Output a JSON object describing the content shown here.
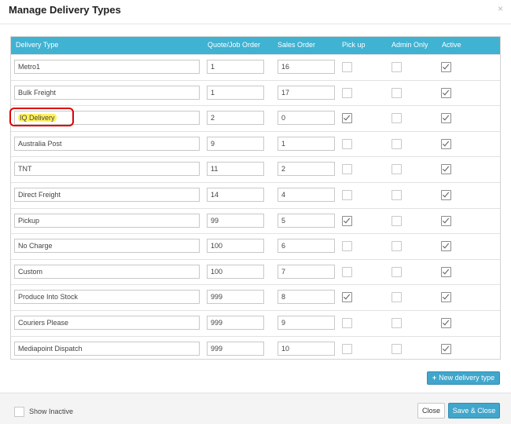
{
  "dialog": {
    "title": "Manage Delivery Types",
    "close_glyph": "×"
  },
  "table": {
    "columns": [
      "Delivery Type",
      "Quote/Job Order",
      "Sales Order",
      "Pick up",
      "Admin Only",
      "Active"
    ],
    "rows": [
      {
        "name": "Metro1",
        "quote_order": "1",
        "sales_order": "16",
        "pickup": false,
        "admin_only": false,
        "active": true
      },
      {
        "name": "Bulk Freight",
        "quote_order": "1",
        "sales_order": "17",
        "pickup": false,
        "admin_only": false,
        "active": true
      },
      {
        "name": "IQ Delivery",
        "quote_order": "2",
        "sales_order": "0",
        "pickup": true,
        "admin_only": false,
        "active": true
      },
      {
        "name": "Australia Post",
        "quote_order": "9",
        "sales_order": "1",
        "pickup": false,
        "admin_only": false,
        "active": true
      },
      {
        "name": "TNT",
        "quote_order": "11",
        "sales_order": "2",
        "pickup": false,
        "admin_only": false,
        "active": true
      },
      {
        "name": "Direct Freight",
        "quote_order": "14",
        "sales_order": "4",
        "pickup": false,
        "admin_only": false,
        "active": true
      },
      {
        "name": "Pickup",
        "quote_order": "99",
        "sales_order": "5",
        "pickup": true,
        "admin_only": false,
        "active": true
      },
      {
        "name": "No Charge",
        "quote_order": "100",
        "sales_order": "6",
        "pickup": false,
        "admin_only": false,
        "active": true
      },
      {
        "name": "Custom",
        "quote_order": "100",
        "sales_order": "7",
        "pickup": false,
        "admin_only": false,
        "active": true
      },
      {
        "name": "Produce Into Stock",
        "quote_order": "999",
        "sales_order": "8",
        "pickup": true,
        "admin_only": false,
        "active": true
      },
      {
        "name": "Couriers Please",
        "quote_order": "999",
        "sales_order": "9",
        "pickup": false,
        "admin_only": false,
        "active": true
      },
      {
        "name": "Mediapoint Dispatch",
        "quote_order": "999",
        "sales_order": "10",
        "pickup": false,
        "admin_only": false,
        "active": true
      }
    ]
  },
  "actions": {
    "new_icon": "plus-icon",
    "new_label": "New delivery type",
    "show_inactive_label": "Show Inactive",
    "show_inactive_checked": false,
    "close_label": "Close",
    "save_close_label": "Save & Close"
  },
  "annotation": {
    "highlighted_row": "IQ Delivery",
    "marker_color": "#e00000",
    "highlight_color": "#fff15c"
  },
  "colors": {
    "header_bg": "#40b2d2",
    "primary_button": "#40a6cc"
  }
}
